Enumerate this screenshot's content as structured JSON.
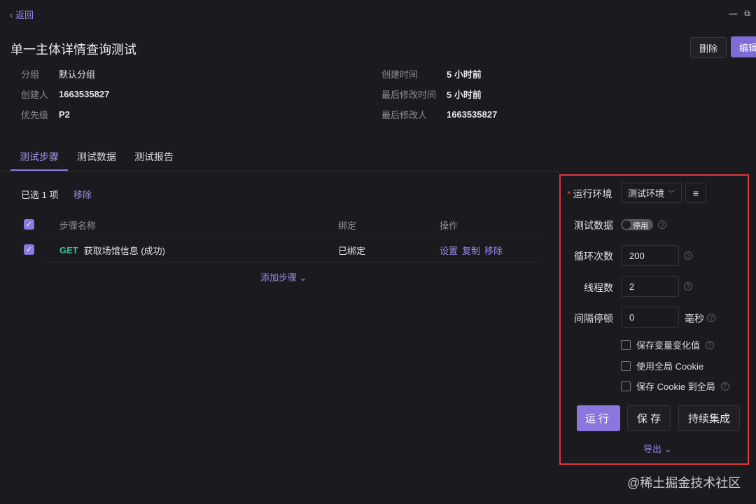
{
  "nav": {
    "back_label": "‹ 返回"
  },
  "window_controls": {
    "minimize": "—",
    "maximize": "⧉"
  },
  "title": "单一主体详情查询测试",
  "actions": {
    "delete": "删除",
    "edit": "编辑"
  },
  "meta_left": [
    {
      "label": "分组",
      "value": "默认分组"
    },
    {
      "label": "创建人",
      "value": "1663535827"
    },
    {
      "label": "优先级",
      "value": "P2"
    }
  ],
  "meta_right": [
    {
      "label": "创建时间",
      "value": "5 小时前"
    },
    {
      "label": "最后修改时间",
      "value": "5 小时前"
    },
    {
      "label": "最后修改人",
      "value": "1663535827"
    }
  ],
  "tabs": [
    {
      "label": "测试步骤",
      "active": true
    },
    {
      "label": "测试数据",
      "active": false
    },
    {
      "label": "测试报告",
      "active": false
    }
  ],
  "selection": {
    "info": "已选 1 项",
    "remove": "移除"
  },
  "table": {
    "headers": [
      "步骤名称",
      "绑定",
      "操作"
    ],
    "rows": [
      {
        "method": "GET",
        "name": "获取场馆信息 (成功)",
        "binding": "已绑定",
        "ops": [
          "设置",
          "复制",
          "移除"
        ]
      }
    ],
    "add_step": "添加步骤 ⌄"
  },
  "panel": {
    "env_label": "运行环境",
    "env_required": "*",
    "env_value": "测试环境",
    "data_label": "测试数据",
    "data_toggle": "停用",
    "loop_label": "循环次数",
    "loop_value": "200",
    "threads_label": "线程数",
    "threads_value": "2",
    "interval_label": "间隔停顿",
    "interval_value": "0",
    "interval_unit": "毫秒",
    "options": [
      {
        "label": "保存变量变化值",
        "checked": false,
        "help": true
      },
      {
        "label": "使用全局 Cookie",
        "checked": false,
        "help": false
      },
      {
        "label": "保存 Cookie 到全局",
        "checked": false,
        "help": true
      }
    ],
    "btn_run": "运行",
    "btn_save": "保 存",
    "btn_ci": "持续集成",
    "export": "导出 ⌄"
  },
  "watermark": "@稀土掘金技术社区",
  "colors": {
    "accent": "#8c78e0",
    "highlight_border": "#e0353a",
    "get_method": "#3dbf8f"
  }
}
